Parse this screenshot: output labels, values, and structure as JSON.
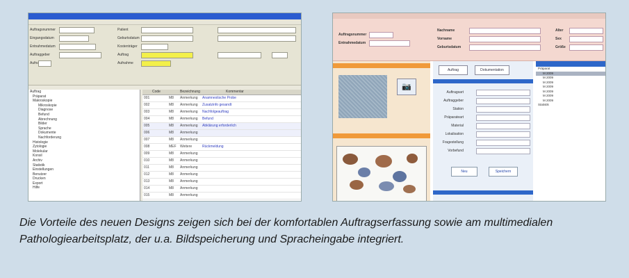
{
  "caption": "Die Vorteile des neuen Designs zeigen sich bei der komfortablen Auftragserfassung sowie am multimedialen Pathologiearbeitsplatz, der u.a. Bildspeicherung und Spracheingabe integriert.",
  "screenshot_left": {
    "form_labels": [
      "Auftragsnummer",
      "Eingangsdatum",
      "Entnahmedatum",
      "Auftraggeber",
      "Aufnahme"
    ],
    "form_labels_2": [
      "Patient",
      "Geburtsdatum",
      "Kostenträger",
      "Auftrag",
      "Aufnahme"
    ],
    "tree_items": [
      "Auftrag",
      "Präparat",
      "Makroskopie",
      "Mikroskopie",
      "Diagnose",
      "Befund",
      "Abrechnung",
      "Bilder",
      "Sprache",
      "Dokumente",
      "Nachforderung",
      "Histologie",
      "Zytologie",
      "Molekular",
      "Konsil",
      "Archiv",
      "Statistik",
      "Einstellungen",
      "Benutzer",
      "Drucken",
      "Export",
      "Hilfe"
    ],
    "grid_header": [
      "Code",
      "Bezeichnung",
      "Kommentar"
    ],
    "grid_rows": [
      {
        "a": "001",
        "b": "M8",
        "c": "Anmerkung",
        "text": "Anamnestische Probe"
      },
      {
        "a": "002",
        "b": "M8",
        "c": "Anmerkung",
        "text": "Zusatzinfo gesandt"
      },
      {
        "a": "003",
        "b": "M8",
        "c": "Anmerkung",
        "text": "Nachfolgeauftrag"
      },
      {
        "a": "004",
        "b": "M8",
        "c": "Anmerkung",
        "text": "Befund"
      },
      {
        "a": "005",
        "b": "M8",
        "c": "Anmerkung",
        "text": "Abklärung erforderlich"
      },
      {
        "a": "006",
        "b": "M8",
        "c": "Anmerkung",
        "text": ""
      },
      {
        "a": "007",
        "b": "M8",
        "c": "Anmerkung",
        "text": ""
      },
      {
        "a": "008",
        "b": "MEF",
        "c": "Weitere",
        "text": "Rückmeldung"
      },
      {
        "a": "009",
        "b": "M8",
        "c": "Anmerkung",
        "text": ""
      },
      {
        "a": "010",
        "b": "M8",
        "c": "Anmerkung",
        "text": ""
      },
      {
        "a": "011",
        "b": "M8",
        "c": "Anmerkung",
        "text": ""
      },
      {
        "a": "012",
        "b": "M8",
        "c": "Anmerkung",
        "text": ""
      },
      {
        "a": "013",
        "b": "M8",
        "c": "Anmerkung",
        "text": ""
      },
      {
        "a": "014",
        "b": "M8",
        "c": "Anmerkung",
        "text": ""
      },
      {
        "a": "015",
        "b": "M8",
        "c": "Anmerkung",
        "text": ""
      }
    ]
  },
  "screenshot_right": {
    "header_labels": [
      "Auftragsnummer",
      "Entnahmedatum"
    ],
    "header_labels_mid": [
      "Nachname",
      "Vorname",
      "Geburtsdatum"
    ],
    "header_labels_right": [
      "Alter",
      "Sex",
      "Größe"
    ],
    "tabs": [
      "Auftrag",
      "Dokumentation"
    ],
    "center_labels": [
      "Auftragsart",
      "Auftraggeber",
      "Station",
      "Präparateart",
      "Material",
      "Lokalisation",
      "Fragestellung",
      "Vorbefund"
    ],
    "center_buttons": [
      "Neu",
      "Speichern"
    ],
    "right_rows": [
      "Präparat",
      "M 2009",
      "M 2009",
      "M 2009",
      "M 2009",
      "M 2009",
      "M 2009",
      "M 2009",
      "Statistik",
      "",
      "",
      "",
      "",
      "",
      "",
      ""
    ],
    "camera_icon": "camera-icon"
  },
  "colors": {
    "background": "#cfdde9",
    "left_titlebar": "#2a5bd0",
    "right_header": "#f4d8d0",
    "accent_orange": "#f09a3a",
    "accent_blue": "#2e67c9"
  }
}
